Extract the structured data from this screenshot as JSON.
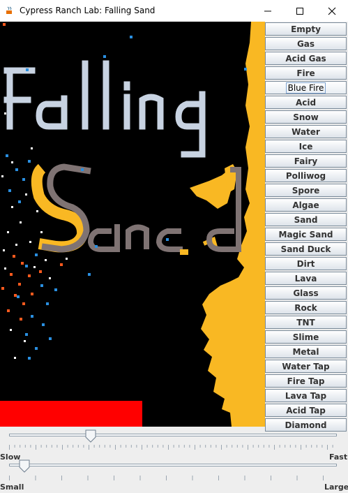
{
  "window": {
    "title": "Cypress Ranch Lab: Falling Sand",
    "minimize_icon": "minimize-icon",
    "maximize_icon": "maximize-icon",
    "close_icon": "close-icon"
  },
  "canvas": {
    "drawn_text_1": "Falling",
    "drawn_text_2": "Sand",
    "colors": {
      "background": "#000000",
      "sand": "#f9b823",
      "rock": "#7f7373",
      "text": "#c8d3e2",
      "red_block": "#ff0000",
      "water": "#2a8fe0",
      "fire": "#ff5a1e"
    }
  },
  "elements": {
    "selected": "Blue Fire",
    "buttons": [
      "Empty",
      "Gas",
      "Acid Gas",
      "Fire",
      "Blue Fire",
      "Acid",
      "Snow",
      "Water",
      "Ice",
      "Fairy",
      "Polliwog",
      "Spore",
      "Algae",
      "Sand",
      "Magic Sand",
      "Sand Duck",
      "Dirt",
      "Lava",
      "Glass",
      "Rock",
      "TNT",
      "Slime",
      "Metal",
      "Water Tap",
      "Fire Tap",
      "Lava Tap",
      "Acid Tap",
      "Diamond"
    ]
  },
  "speed_slider": {
    "label_min": "Slow",
    "label_max": "Fast",
    "value": 0.25
  },
  "size_slider": {
    "label_min": "Small",
    "label_max": "Large",
    "value": 0.05
  }
}
